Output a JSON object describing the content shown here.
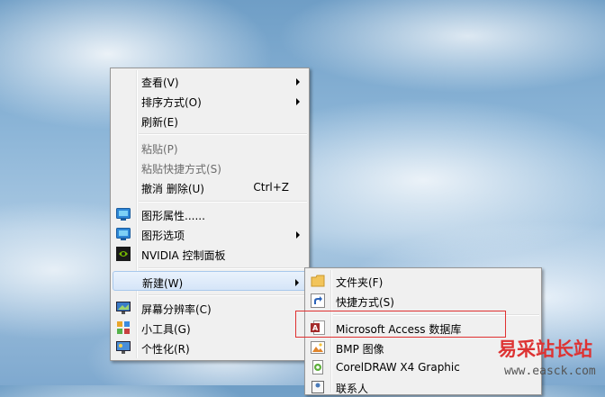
{
  "context_menu": {
    "items": [
      {
        "label": "查看(V)"
      },
      {
        "label": "排序方式(O)"
      },
      {
        "label": "刷新(E)"
      },
      {
        "label": "粘贴(P)"
      },
      {
        "label": "粘贴快捷方式(S)"
      },
      {
        "label": "撤消 删除(U)",
        "shortcut": "Ctrl+Z"
      },
      {
        "label": "图形属性......"
      },
      {
        "label": "图形选项"
      },
      {
        "label": "NVIDIA 控制面板"
      },
      {
        "label": "新建(W)"
      },
      {
        "label": "屏幕分辨率(C)"
      },
      {
        "label": "小工具(G)"
      },
      {
        "label": "个性化(R)"
      }
    ]
  },
  "new_submenu": {
    "items": [
      {
        "label": "文件夹(F)"
      },
      {
        "label": "快捷方式(S)"
      },
      {
        "label": "Microsoft Access 数据库"
      },
      {
        "label": "BMP 图像"
      },
      {
        "label": "CorelDRAW X4 Graphic"
      },
      {
        "label": "联系人"
      }
    ]
  },
  "watermark": {
    "title": "易采站长站",
    "url": "www.easck.com"
  }
}
